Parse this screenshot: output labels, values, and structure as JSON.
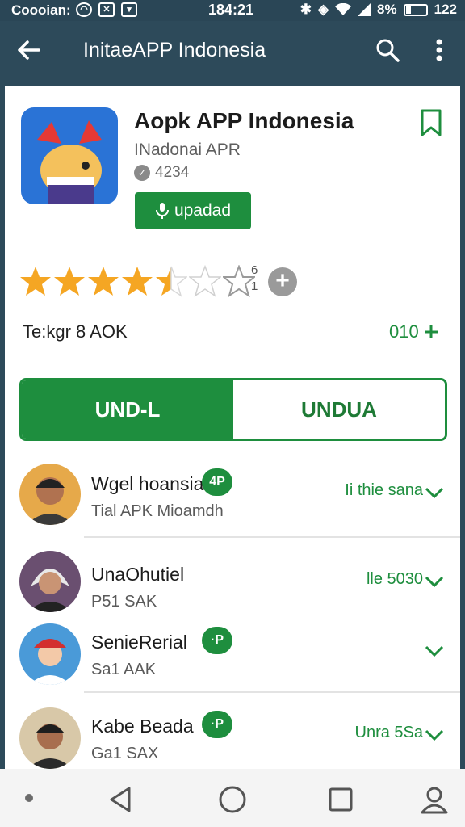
{
  "status_bar": {
    "carrier": "Coooian:",
    "time": "184:21",
    "battery_pct": "8%",
    "extra": "122"
  },
  "app_bar": {
    "title": "InitaeAPP Indonesia",
    "icons": [
      "back-arrow-icon",
      "search-icon",
      "more-vert-icon"
    ]
  },
  "app": {
    "name": "Aopk APP Indonesia",
    "developer": "INadonai APR",
    "count": "4234",
    "update_label": "upadad",
    "rating_stars": 4.5,
    "rating_meta_top": "6",
    "rating_meta_bottom": "1"
  },
  "info": {
    "left": "Te:kgr 8 AOK",
    "right": "010"
  },
  "segmented": {
    "left_label": "UND-L",
    "right_label": "UNDUA"
  },
  "reviews": [
    {
      "name": "Wgel hoansia",
      "sub": "Tial APK Mioamdh",
      "badge": "4P",
      "right": "Ii thie sana"
    },
    {
      "name": "UnaOhutiel",
      "sub": "P51 SAK",
      "badge": "",
      "right": "lle 5030"
    },
    {
      "name": "SenieRerial",
      "sub": "Sa1 AAK",
      "badge": "·P",
      "right": ""
    },
    {
      "name": "Kabe Beada",
      "sub": "Ga1 SAX",
      "badge": "·P",
      "right": "Unra 5Sa"
    }
  ],
  "colors": {
    "toolbar": "#2d4a5a",
    "accent_green": "#1e8e3e",
    "star": "#f5a623"
  },
  "nav_bar": {
    "icons": [
      "nav-dot-icon",
      "back-triangle-icon",
      "home-circle-icon",
      "recents-square-icon",
      "profile-icon"
    ]
  }
}
